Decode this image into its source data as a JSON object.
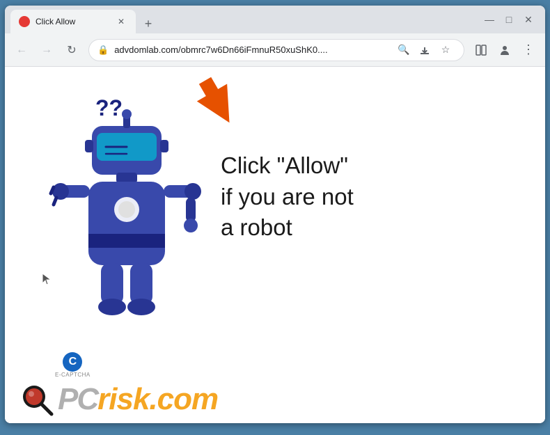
{
  "browser": {
    "tab": {
      "title": "Click Allow",
      "favicon_color": "#e53935"
    },
    "address": {
      "url": "advdomlab.com/obmrc7w6Dn66iFmnuR50xuShK0....",
      "lock_icon": "🔒"
    },
    "window_controls": {
      "minimize": "—",
      "maximize": "□",
      "close": "✕"
    },
    "new_tab_label": "+"
  },
  "page": {
    "main_text_line1": "Click \"Allow\"",
    "main_text_line2": "if you are not",
    "main_text_line3": "a robot",
    "ecaptcha_letter": "C",
    "ecaptcha_label": "E-CAPTCHA",
    "pcrisk_pc": "PC",
    "pcrisk_risk": "risk.com"
  },
  "nav": {
    "back": "←",
    "forward": "→",
    "reload": "↻",
    "search_icon": "🔍",
    "share_icon": "⬆",
    "bookmark_icon": "☆",
    "split_icon": "▣",
    "profile_icon": "👤",
    "menu_icon": "⋮"
  }
}
